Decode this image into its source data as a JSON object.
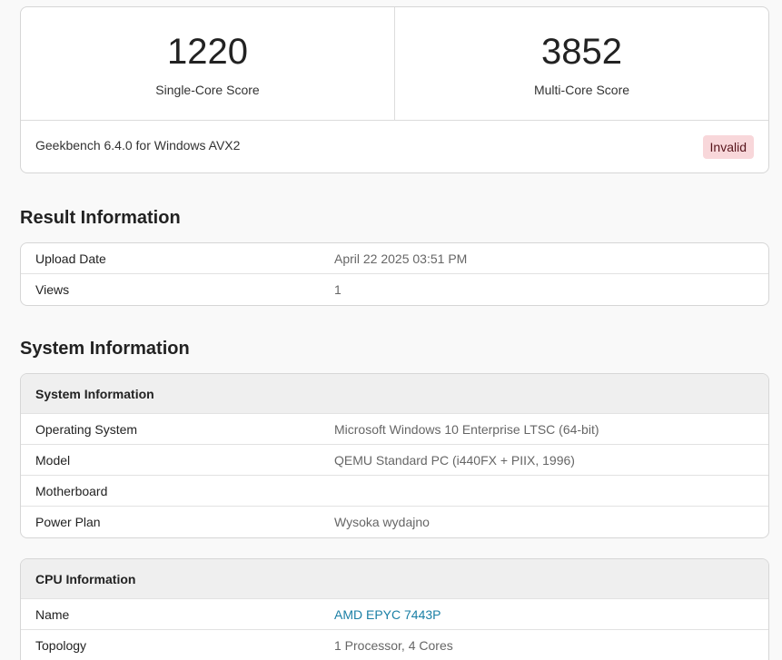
{
  "scores": {
    "single_value": "1220",
    "single_label": "Single-Core Score",
    "multi_value": "3852",
    "multi_label": "Multi-Core Score",
    "version": "Geekbench 6.4.0 for Windows AVX2",
    "badge": "Invalid"
  },
  "result_info": {
    "title": "Result Information",
    "rows": [
      {
        "key": "Upload Date",
        "value": "April 22 2025 03:51 PM"
      },
      {
        "key": "Views",
        "value": "1"
      }
    ]
  },
  "system_info": {
    "title": "System Information",
    "table_title": "System Information",
    "rows": [
      {
        "key": "Operating System",
        "value": "Microsoft Windows 10 Enterprise LTSC (64-bit)"
      },
      {
        "key": "Model",
        "value": "QEMU Standard PC (i440FX + PIIX, 1996)"
      },
      {
        "key": "Motherboard",
        "value": ""
      },
      {
        "key": "Power Plan",
        "value": "Wysoka wydajno"
      }
    ]
  },
  "cpu_info": {
    "table_title": "CPU Information",
    "rows": [
      {
        "key": "Name",
        "value": "AMD EPYC 7443P"
      },
      {
        "key": "Topology",
        "value": "1 Processor, 4 Cores"
      }
    ]
  },
  "colors": {
    "badge_bg": "#f8d7da",
    "link": "#1a7fa5"
  }
}
